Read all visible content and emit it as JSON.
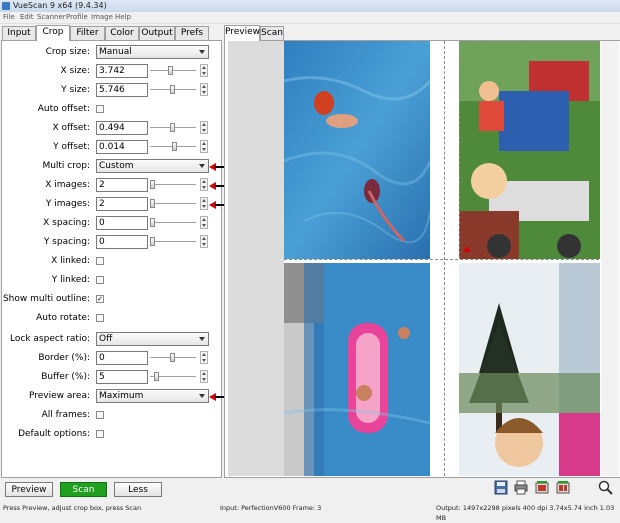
{
  "window": {
    "title": "VueScan 9 x64 (9.4.34)"
  },
  "menu": [
    "File",
    "Edit",
    "Scanner",
    "Profile",
    "Image",
    "Help"
  ],
  "left_tabs": [
    "Input",
    "Crop",
    "Filter",
    "Color",
    "Output",
    "Prefs"
  ],
  "active_left_tab": "Crop",
  "right_tabs": [
    "Preview",
    "Scan"
  ],
  "active_right_tab": "Preview",
  "crop": {
    "crop_size": {
      "label": "Crop size:",
      "value": "Manual"
    },
    "x_size": {
      "label": "X size:",
      "value": "3.742"
    },
    "y_size": {
      "label": "Y size:",
      "value": "5.746"
    },
    "auto_offset": {
      "label": "Auto offset:",
      "checked": false
    },
    "x_offset": {
      "label": "X offset:",
      "value": "0.494"
    },
    "y_offset": {
      "label": "Y offset:",
      "value": "0.014"
    },
    "multi_crop": {
      "label": "Multi crop:",
      "value": "Custom"
    },
    "x_images": {
      "label": "X images:",
      "value": "2"
    },
    "y_images": {
      "label": "Y images:",
      "value": "2"
    },
    "x_spacing": {
      "label": "X spacing:",
      "value": "0"
    },
    "y_spacing": {
      "label": "Y spacing:",
      "value": "0"
    },
    "x_linked": {
      "label": "X linked:",
      "checked": false
    },
    "y_linked": {
      "label": "Y linked:",
      "checked": false
    },
    "show_multi_outline": {
      "label": "Show multi outline:",
      "checked": true,
      "mark": "✓"
    },
    "auto_rotate": {
      "label": "Auto rotate:",
      "checked": false
    },
    "lock_aspect_ratio": {
      "label": "Lock aspect ratio:",
      "value": "Off"
    },
    "border": {
      "label": "Border (%):",
      "value": "0"
    },
    "buffer": {
      "label": "Buffer (%):",
      "value": "5"
    },
    "preview_area": {
      "label": "Preview area:",
      "value": "Maximum"
    },
    "all_frames": {
      "label": "All frames:",
      "checked": false
    },
    "default_options": {
      "label": "Default options:",
      "checked": false
    }
  },
  "buttons": {
    "preview": "Preview",
    "scan": "Scan",
    "less": "Less"
  },
  "toolbar_icons": [
    "save-icon",
    "print-icon",
    "scan-single-icon",
    "scan-all-icon",
    "zoom-icon"
  ],
  "status": {
    "left": "Press Preview, adjust crop box, press Scan",
    "middle": "Input: PerfectionV600 Frame: 3",
    "right": "Output: 1497x2298 pixels 400 dpi 3.74x5.74 inch 1.03 MB"
  },
  "colors": {
    "scan_button": "#1fa01f",
    "annotation_arrow": "#d00000",
    "pool_water": "#3a8cc8"
  }
}
